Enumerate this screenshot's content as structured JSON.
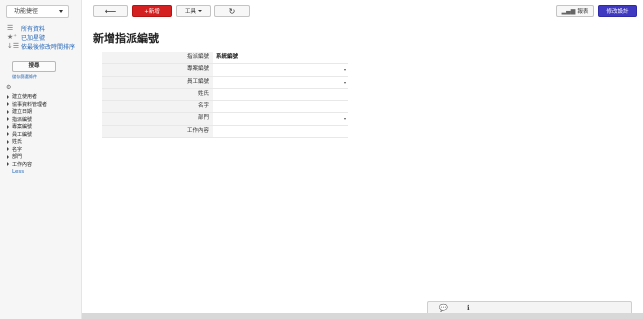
{
  "sidebar": {
    "shortcut_label": "功能捷徑",
    "links": [
      {
        "label": "所有資料",
        "icon": "list-icon"
      },
      {
        "label": "已加星號",
        "icon": "star-icon"
      },
      {
        "label": "依最後修改時間排序",
        "icon": "sort-icon"
      }
    ],
    "search_label": "搜尋",
    "search_hint": "儲存篩選條件",
    "fields": [
      "建立使用者",
      "協事資料管理者",
      "建立日期",
      "指派編號",
      "專案編號",
      "員工編號",
      "姓氏",
      "名字",
      "部門",
      "工作內容"
    ],
    "less_label": "Less"
  },
  "toolbar": {
    "new_label": "+新增",
    "tools_label": "工具",
    "report_label": "報表",
    "edit_design_label": "修改設計"
  },
  "page": {
    "title": "新增指派編號"
  },
  "form": {
    "assign_no_label": "指派編號",
    "assign_no_value": "系統編號",
    "project_no_label": "專案編號",
    "employee_no_label": "員工編號",
    "last_name_label": "姓氏",
    "first_name_label": "名字",
    "department_label": "部門",
    "work_content_label": "工作內容"
  },
  "colors": {
    "new_button": "#d42020",
    "edit_design_button": "#3f39c2",
    "link": "#2a6ab8"
  }
}
